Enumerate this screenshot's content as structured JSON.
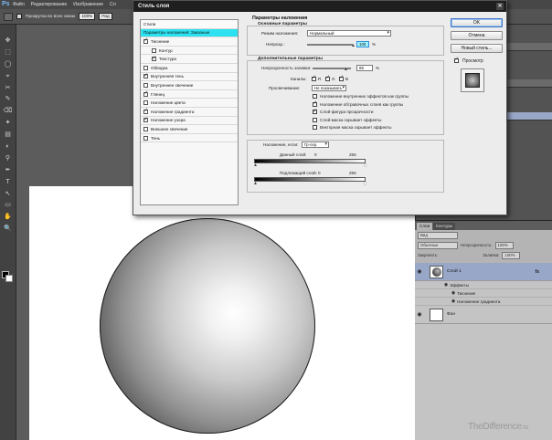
{
  "menubar": {
    "logo": "Ps",
    "items": [
      "Файл",
      "Редактирование",
      "Изображение",
      "Сл"
    ]
  },
  "options": {
    "scroll_all_windows": "Прокрутка во всех окнах",
    "zoom": "100%",
    "fit_label": "Под"
  },
  "tools": {
    "glyphs": [
      "✥",
      "⬚",
      "◯",
      "⌖",
      "✂",
      "✎",
      "⌫",
      "✦",
      "▤",
      "◐",
      "⚲",
      "✒",
      "T",
      "↖",
      "▭",
      "✋",
      "🔍"
    ]
  },
  "dialog": {
    "title": "Стиль слоя",
    "close": "✕",
    "styles_header": "Стили",
    "styles": [
      {
        "label": "Параметры наложения: Заказные",
        "checkbox": false,
        "checked": false,
        "active": true,
        "indent": false
      },
      {
        "label": "Тиснение",
        "checkbox": true,
        "checked": true,
        "active": false,
        "indent": false
      },
      {
        "label": "Контур",
        "checkbox": true,
        "checked": false,
        "active": false,
        "indent": true
      },
      {
        "label": "Текстура",
        "checkbox": true,
        "checked": true,
        "active": false,
        "indent": true
      },
      {
        "label": "Обводка",
        "checkbox": true,
        "checked": false,
        "active": false,
        "indent": false
      },
      {
        "label": "Внутренняя тень",
        "checkbox": true,
        "checked": true,
        "active": false,
        "indent": false
      },
      {
        "label": "Внутреннее свечение",
        "checkbox": true,
        "checked": false,
        "active": false,
        "indent": false
      },
      {
        "label": "Глянец",
        "checkbox": true,
        "checked": true,
        "active": false,
        "indent": false
      },
      {
        "label": "Наложение цвета",
        "checkbox": true,
        "checked": false,
        "active": false,
        "indent": false
      },
      {
        "label": "Наложение градиента",
        "checkbox": true,
        "checked": true,
        "active": false,
        "indent": false
      },
      {
        "label": "Наложение узора",
        "checkbox": true,
        "checked": true,
        "active": false,
        "indent": false
      },
      {
        "label": "Внешнее свечение",
        "checkbox": true,
        "checked": false,
        "active": false,
        "indent": false
      },
      {
        "label": "Тень",
        "checkbox": true,
        "checked": false,
        "active": false,
        "indent": false
      }
    ],
    "blending": {
      "title": "Параметры наложения",
      "general_title": "Основные параметры",
      "mode_label": "Режим наложения:",
      "mode_value": "Нормальный",
      "opacity_label": "Непрозр.:",
      "opacity_value": "100",
      "unit": "%"
    },
    "advanced": {
      "title": "Дополнительные параметры",
      "fill_label": "Непрозрачность заливки:",
      "fill_value": "85",
      "unit": "%",
      "channels_label": "Каналы:",
      "channels": [
        "R",
        "G",
        "B"
      ],
      "knockout_label": "Просвечивание:",
      "knockout_value": "Не показывать",
      "options": [
        {
          "label": "Наложение внутренних эффектов как группы",
          "checked": false
        },
        {
          "label": "Наложение обтравочных слоев как группы",
          "checked": true
        },
        {
          "label": "Слой-фигура прозрачности",
          "checked": true
        },
        {
          "label": "Слой-маска скрывает эффекты",
          "checked": false
        },
        {
          "label": "Векторная маска скрывает эффекты",
          "checked": false
        }
      ]
    },
    "blend_if": {
      "label": "Наложение, если:",
      "value": "Гр-сер.",
      "this_layer_label": "Данный слой:",
      "this_layer_min": "0",
      "this_layer_max": "255",
      "underlying_label": "Подлежащий слой:",
      "underlying_min": "0",
      "underlying_max": "255"
    },
    "buttons": {
      "ok": "OK",
      "cancel": "Отмена",
      "new_style": "Новый стиль...",
      "preview": "Просмотр"
    }
  },
  "layers": {
    "tabs": [
      "Слои",
      "Контуры"
    ],
    "kind_filter": "Вид",
    "blend_mode": "Обычные",
    "opacity_label": "Непрозрачность:",
    "opacity_value": "100%",
    "lock_label": "Закрепить:",
    "fill_label": "Заливка:",
    "fill_value": "100%",
    "items": [
      {
        "name": "Слой 1",
        "selected": true,
        "fx": "fx"
      },
      {
        "name": "Фон",
        "selected": false
      }
    ],
    "effects_label": "Эффекты",
    "effects": [
      "Тиснение",
      "Наложение градиента"
    ]
  },
  "watermark": {
    "brand": "TheDifference",
    "domain": ".ru"
  }
}
